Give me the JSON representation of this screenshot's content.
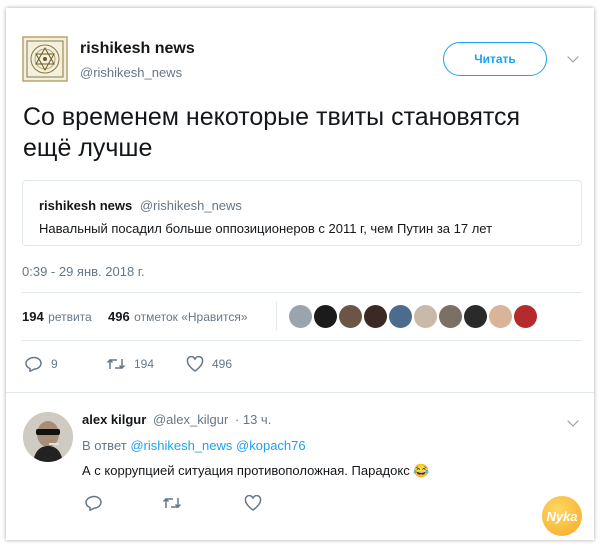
{
  "tweet": {
    "author_name": "rishikesh news",
    "author_handle": "@rishikesh_news",
    "follow_label": "Читать",
    "text_line1": "Со временем некоторые твиты становятся",
    "text_line2": "ещё лучше",
    "quote": {
      "author_name": "rishikesh news",
      "author_handle": "@rishikesh_news",
      "text": "Навальный посадил больше оппозиционеров с 2011 г, чем Путин за 17 лет"
    },
    "timestamp": "0:39 - 29 янв. 2018 г.",
    "stats": {
      "retweets_count": "194",
      "retweets_label": "ретвита",
      "likes_count": "496",
      "likes_label": "отметок «Нравится»"
    },
    "actions": {
      "reply_count": "9",
      "retweet_count": "194",
      "like_count": "496"
    }
  },
  "reply": {
    "author_name": "alex kilgur",
    "author_handle": "@alex_kilgur",
    "time": "· 13 ч.",
    "in_reply_prefix": "В ответ",
    "mention1": "@rishikesh_news",
    "mention2": "@kopach76",
    "text": "А с коррупцией ситуация противоположная. Парадокс",
    "emoji": "😂"
  },
  "watermark": "Nyka",
  "colors": {
    "accent": "#1da1f2",
    "muted": "#657786",
    "border": "#e1e8ed"
  }
}
